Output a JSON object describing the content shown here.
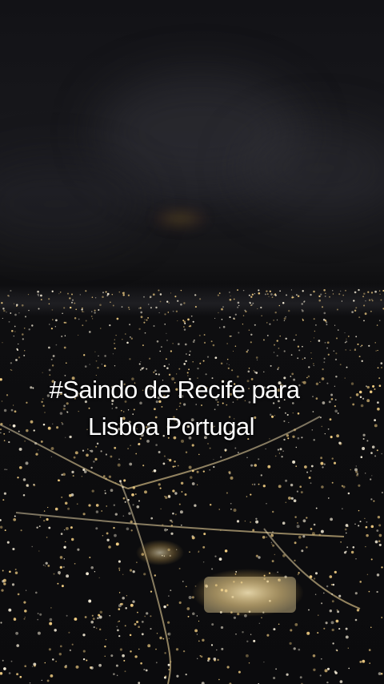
{
  "photo": {
    "subject": "night-aerial-city-lights"
  },
  "caption": {
    "line1": "#Saindo de Recife para",
    "line2": "Lisboa Portugal"
  },
  "colors": {
    "sky": "#17171b",
    "ground": "#0b0b0d",
    "light_warm": "#ffd98a",
    "light_white": "#fff6e0",
    "caption_text": "#ffffff"
  }
}
